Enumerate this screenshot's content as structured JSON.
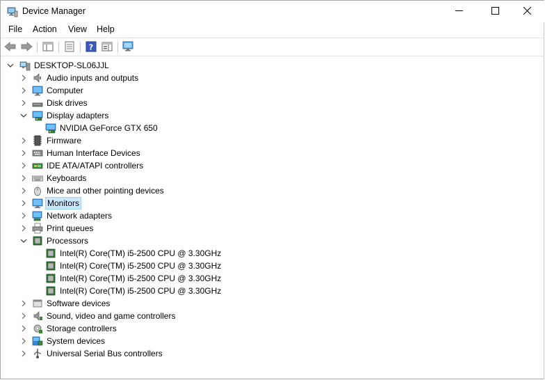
{
  "window": {
    "title": "Device Manager"
  },
  "menu": [
    "File",
    "Action",
    "View",
    "Help"
  ],
  "tree": {
    "root": "DESKTOP-SL06JJL",
    "categories": [
      {
        "label": "Audio inputs and outputs",
        "icon": "speaker-icon",
        "expanded": false
      },
      {
        "label": "Computer",
        "icon": "computer-icon",
        "expanded": false
      },
      {
        "label": "Disk drives",
        "icon": "disk-drive-icon",
        "expanded": false
      },
      {
        "label": "Display adapters",
        "icon": "display-adapter-icon",
        "expanded": true,
        "children": [
          "NVIDIA GeForce GTX 650"
        ]
      },
      {
        "label": "Firmware",
        "icon": "firmware-icon",
        "expanded": false
      },
      {
        "label": "Human Interface Devices",
        "icon": "hid-icon",
        "expanded": false
      },
      {
        "label": "IDE ATA/ATAPI controllers",
        "icon": "ide-controller-icon",
        "expanded": false
      },
      {
        "label": "Keyboards",
        "icon": "keyboard-icon",
        "expanded": false
      },
      {
        "label": "Mice and other pointing devices",
        "icon": "mouse-icon",
        "expanded": false
      },
      {
        "label": "Monitors",
        "icon": "monitor-icon",
        "expanded": false,
        "selected": true
      },
      {
        "label": "Network adapters",
        "icon": "network-adapter-icon",
        "expanded": false
      },
      {
        "label": "Print queues",
        "icon": "printer-icon",
        "expanded": false
      },
      {
        "label": "Processors",
        "icon": "processor-icon",
        "expanded": true,
        "children": [
          "Intel(R) Core(TM) i5-2500 CPU @ 3.30GHz",
          "Intel(R) Core(TM) i5-2500 CPU @ 3.30GHz",
          "Intel(R) Core(TM) i5-2500 CPU @ 3.30GHz",
          "Intel(R) Core(TM) i5-2500 CPU @ 3.30GHz"
        ]
      },
      {
        "label": "Software devices",
        "icon": "software-device-icon",
        "expanded": false
      },
      {
        "label": "Sound, video and game controllers",
        "icon": "sound-controller-icon",
        "expanded": false
      },
      {
        "label": "Storage controllers",
        "icon": "storage-controller-icon",
        "expanded": false
      },
      {
        "label": "System devices",
        "icon": "system-device-icon",
        "expanded": false
      },
      {
        "label": "Universal Serial Bus controllers",
        "icon": "usb-icon",
        "expanded": false
      }
    ]
  },
  "colors": {
    "selection_bg": "#cce8ff",
    "selection_border": "#99d1ff"
  }
}
